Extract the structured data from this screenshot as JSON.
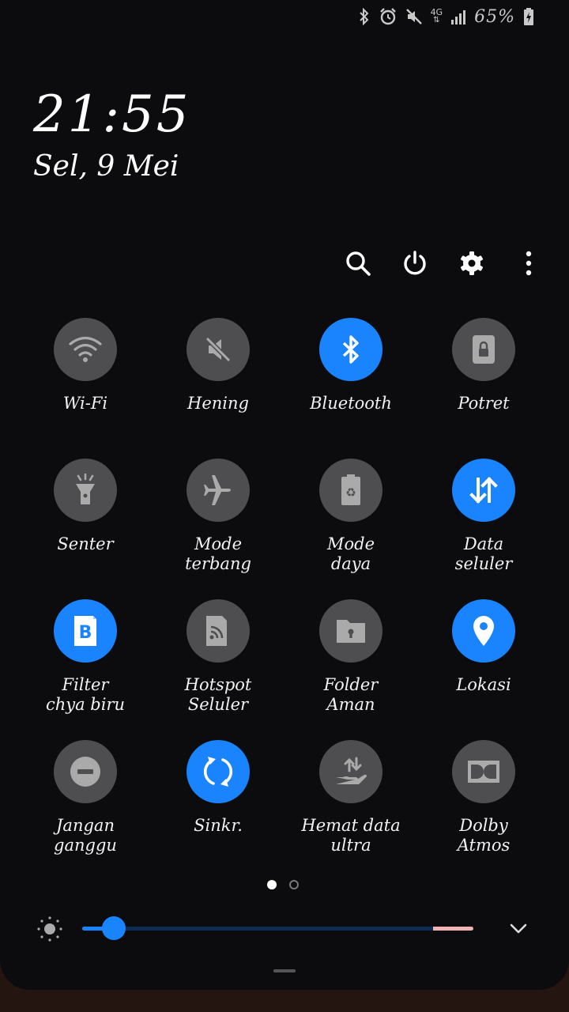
{
  "status_bar": {
    "network": "4G",
    "battery_percent": "65%",
    "icons": [
      "bluetooth-icon",
      "alarm-icon",
      "mute-icon",
      "network-4g-icon",
      "signal-icon",
      "battery-charging-icon"
    ]
  },
  "clock": {
    "time": "21:55",
    "date": "Sel, 9 Mei"
  },
  "toolbar": {
    "icons": [
      "search-icon",
      "power-icon",
      "settings-icon",
      "more-icon"
    ]
  },
  "tiles": [
    {
      "label": "Wi-Fi",
      "icon": "wifi-icon",
      "on": false
    },
    {
      "label": "Hening",
      "icon": "mute-icon",
      "on": false
    },
    {
      "label": "Bluetooth",
      "icon": "bluetooth-icon",
      "on": true
    },
    {
      "label": "Potret",
      "icon": "portrait-lock-icon",
      "on": false
    },
    {
      "label": "Senter",
      "icon": "flashlight-icon",
      "on": false
    },
    {
      "label": "Mode\nterbang",
      "icon": "airplane-icon",
      "on": false
    },
    {
      "label": "Mode\ndaya",
      "icon": "power-mode-icon",
      "on": false
    },
    {
      "label": "Data\nseluler",
      "icon": "mobile-data-icon",
      "on": true
    },
    {
      "label": "Filter\nchya biru",
      "icon": "blue-light-filter-icon",
      "on": true
    },
    {
      "label": "Hotspot\nSeluler",
      "icon": "hotspot-icon",
      "on": false
    },
    {
      "label": "Folder\nAman",
      "icon": "secure-folder-icon",
      "on": false
    },
    {
      "label": "Lokasi",
      "icon": "location-icon",
      "on": true
    },
    {
      "label": "Jangan\nganggu",
      "icon": "do-not-disturb-icon",
      "on": false
    },
    {
      "label": "Sinkr.",
      "icon": "sync-icon",
      "on": true
    },
    {
      "label": "Hemat data\nultra",
      "icon": "data-saver-icon",
      "on": false
    },
    {
      "label": "Dolby\nAtmos",
      "icon": "dolby-icon",
      "on": false
    }
  ],
  "pager": {
    "pages": 2,
    "current": 1
  },
  "brightness": {
    "level": 0.08,
    "icon": "brightness-icon"
  },
  "colors": {
    "accent": "#1a84ff",
    "tile_off": "#4e4e50",
    "background": "#0c0c0e"
  }
}
